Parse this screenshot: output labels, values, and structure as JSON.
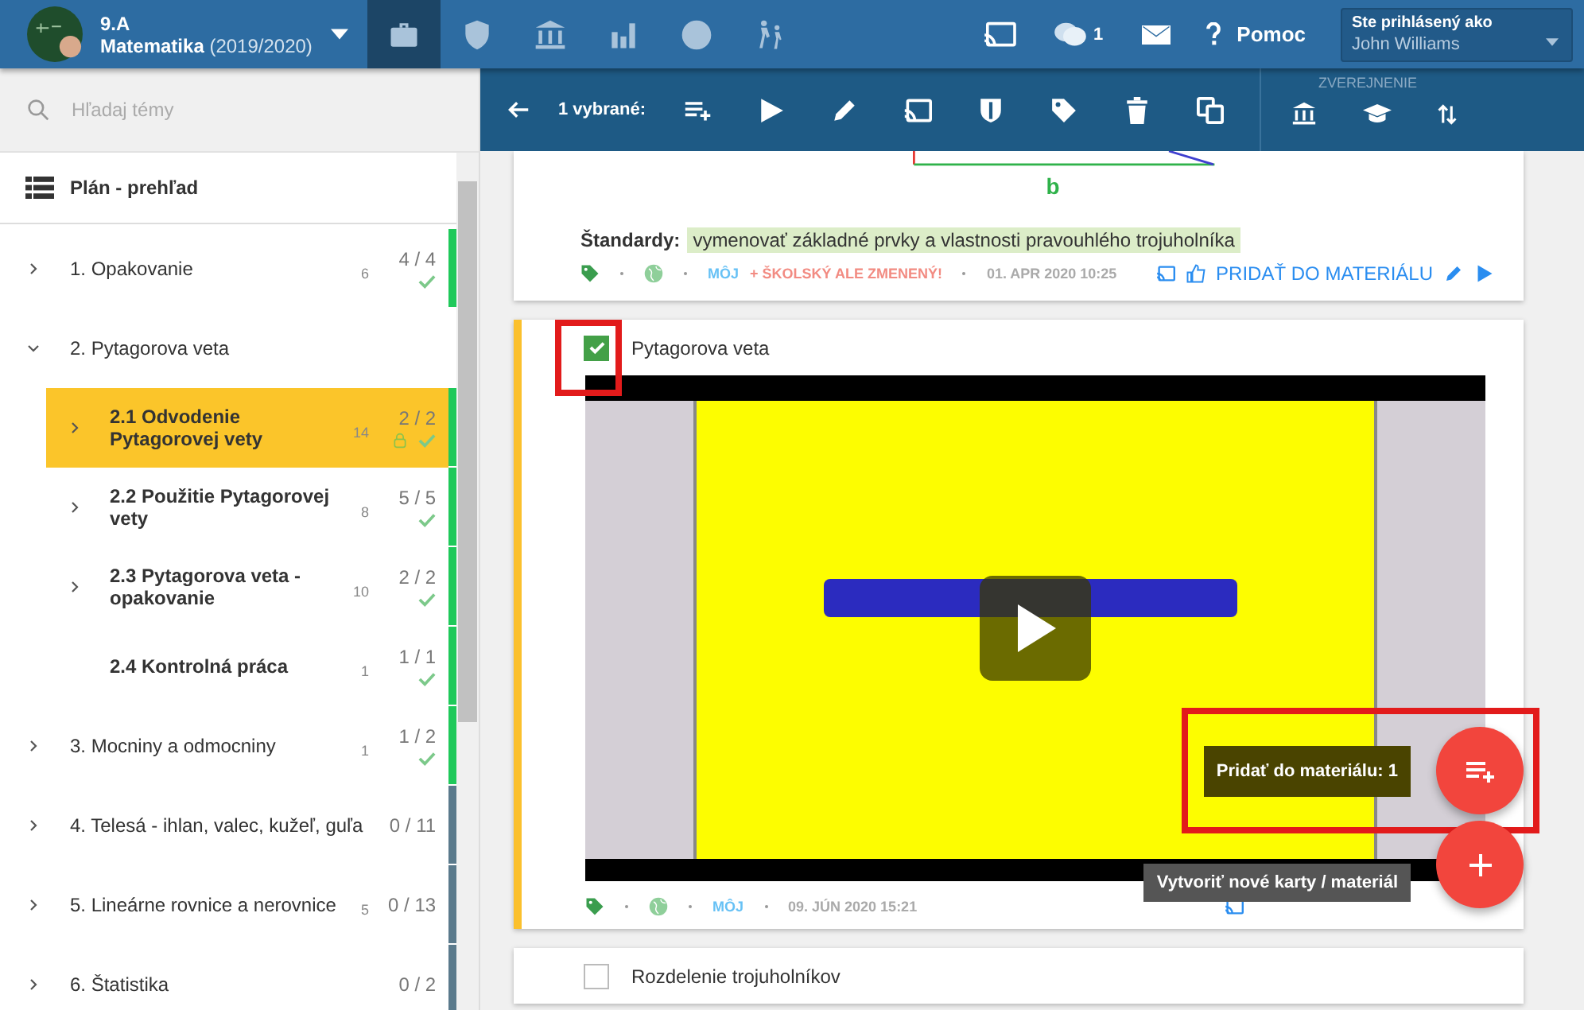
{
  "header": {
    "class_name": "9.A",
    "subject": "Matematika",
    "year": "(2019/2020)",
    "nav": [
      {
        "selected": true
      },
      {
        "selected": false
      },
      {
        "selected": false
      },
      {
        "selected": false
      },
      {
        "selected": false
      },
      {
        "selected": false
      }
    ],
    "chat_count": "1",
    "help": "Pomoc",
    "user": {
      "caption": "Ste prihlásený ako",
      "name": "John Williams"
    }
  },
  "search": {
    "placeholder": "Hľadaj témy"
  },
  "toolbar": {
    "selection": "1 vybrané:",
    "publish_label": "ZVEREJNENIE"
  },
  "sidebar": {
    "title": "Plán - prehľad",
    "topics": [
      {
        "label": "1. Opakovanie",
        "count": "6",
        "progress": "4 / 4",
        "done": true,
        "expanded": false,
        "selected": false,
        "color": "#1fc95a"
      },
      {
        "label": "2. Pytagorova veta",
        "expanded": true,
        "selected": false,
        "children": [
          {
            "label": "2.1  Odvodenie Pytagorovej vety",
            "count": "14",
            "progress": "2 / 2",
            "done": true,
            "locked": true,
            "expanded": false,
            "selected": true,
            "color": "#1fc95a"
          },
          {
            "label": "2.2  Použitie Pytagorovej vety",
            "count": "8",
            "progress": "5 / 5",
            "done": true,
            "locked": false,
            "expanded": false,
            "selected": false,
            "color": "#1fc95a"
          },
          {
            "label": "2.3  Pytagorova veta - opakovanie",
            "count": "10",
            "progress": "2 / 2",
            "done": true,
            "locked": false,
            "expanded": false,
            "selected": false,
            "color": "#1fc95a"
          },
          {
            "label": "2.4  Kontrolná práca",
            "count": "1",
            "progress": "1 / 1",
            "done": true,
            "locked": false,
            "selected": false,
            "color": "#1fc95a"
          }
        ]
      },
      {
        "label": "3. Mocniny a odmocniny",
        "count": "1",
        "progress": "1 / 2",
        "done": true,
        "expanded": false,
        "selected": false,
        "color": "#1fc95a"
      },
      {
        "label": "4. Telesá - ihlan, valec, kužeľ, guľa",
        "progress": "0 / 11",
        "done": false,
        "expanded": false,
        "selected": false,
        "color": "#5a7a8c"
      },
      {
        "label": "5. Lineárne rovnice a nerovnice",
        "count": "5",
        "progress": "0 / 13",
        "done": false,
        "expanded": false,
        "selected": false,
        "color": "#5a7a8c"
      },
      {
        "label": "6. Štatistika",
        "progress": "0 / 2",
        "done": false,
        "expanded": false,
        "selected": false,
        "color": "#5a7a8c"
      }
    ]
  },
  "cards": [
    {
      "kind": "partial",
      "drawing_label": "b",
      "standards_label": "Štandardy:",
      "standards": [
        "vymenovať základné prvky a vlastnosti pravouhlého trojuholníka"
      ],
      "owner": "MÔJ",
      "origin": "+ ŠKOLSKÝ ALE ZMENENÝ!",
      "date": "01. APR 2020 10:25",
      "action": "PRIDAŤ DO MATERIÁLU"
    },
    {
      "kind": "video",
      "checked": true,
      "highlighted": true,
      "title": "Pytagorova veta",
      "owner": "MÔJ",
      "date": "09. JÚN 2020 15:21"
    },
    {
      "kind": "plain",
      "checked": false,
      "highlighted": false,
      "title": "Rozdelenie trojuholníkov"
    }
  ],
  "fab": {
    "add_tooltip": "Pridať do materiálu: 1",
    "add_highlighted": true,
    "create_tooltip": "Vytvoriť nové karty / materiál"
  }
}
